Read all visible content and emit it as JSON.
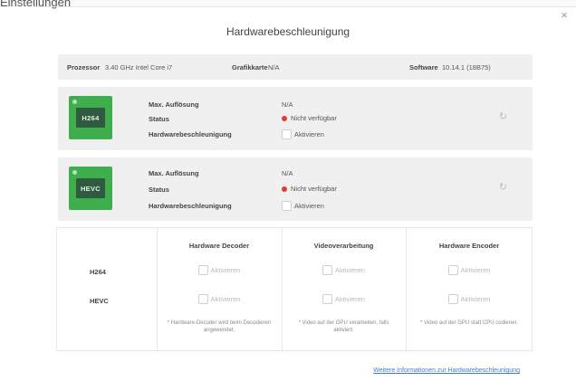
{
  "window": {
    "partial_label": "Einstellungen",
    "close_glyph": "×",
    "title": "Hardwarebeschleunigung"
  },
  "system": {
    "processor_label": "Prozessor",
    "processor_value": "3.40 GHz Intel Core i7",
    "graphics_label": "Grafikkarte",
    "graphics_value": "N/A",
    "software_label": "Software",
    "software_value": "10.14.1 (18B75)"
  },
  "codecs": [
    {
      "chip_label": "H264",
      "max_res_label": "Max. Auflösung",
      "max_res_value": "N/A",
      "status_label": "Status",
      "status_value": "Nicht verfügbar",
      "status_color": "#e53935",
      "hw_accel_label": "Hardwarebeschleunigung",
      "checkbox_label": "Aktivieren",
      "refresh_icon": "refresh-icon"
    },
    {
      "chip_label": "HEVC",
      "max_res_label": "Max. Auflösung",
      "max_res_value": "N/A",
      "status_label": "Status",
      "status_value": "Nicht verfügbar",
      "status_color": "#e53935",
      "hw_accel_label": "Hardwarebeschleunigung",
      "checkbox_label": "Aktivieren",
      "refresh_icon": "refresh-icon"
    }
  ],
  "table": {
    "columns": [
      "Hardware Decoder",
      "Videoverarbeitung",
      "Hardware Encoder"
    ],
    "rows": [
      "H264",
      "HEVC"
    ],
    "checkbox_label": "Aktivieren",
    "notes": [
      "* Hardware-Decoder wird beim Decodieren angewendet.",
      "* Video auf der GPU verarbeiten, falls aktiviert.",
      "* Video auf der GPU statt CPU codieren."
    ]
  },
  "footer": {
    "link_text": "Weitere Informationen zur Hardwarebeschleunigung",
    "link_color": "#3a7fd5"
  }
}
